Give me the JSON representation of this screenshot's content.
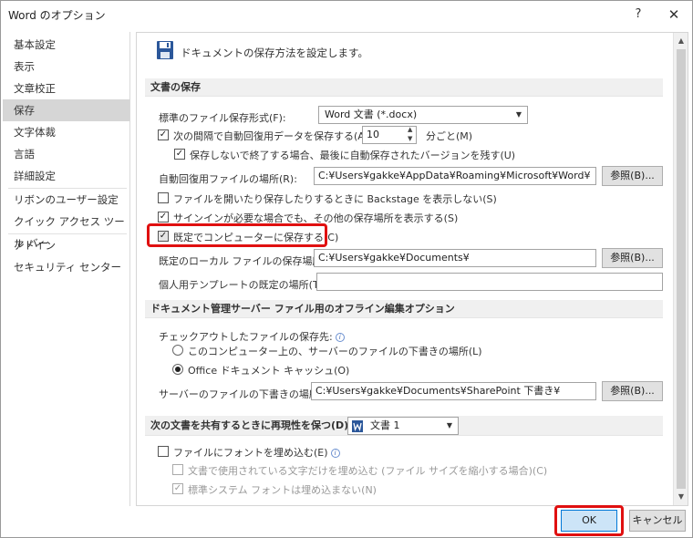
{
  "window": {
    "title": "Word のオプション",
    "help": "?",
    "close": "✕"
  },
  "sidebar": {
    "items": [
      "基本設定",
      "表示",
      "文章校正",
      "保存",
      "文字体裁",
      "言語",
      "詳細設定",
      "リボンのユーザー設定",
      "クイック アクセス ツール バー",
      "アドイン",
      "セキュリティ センター"
    ],
    "selected": "保存"
  },
  "header": {
    "text": "ドキュメントの保存方法を設定します。"
  },
  "sections": {
    "save": "文書の保存",
    "offline": "ドキュメント管理サーバー ファイル用のオフライン編集オプション",
    "share": "次の文書を共有するときに再現性を保つ(D):"
  },
  "save": {
    "format_label": "標準のファイル保存形式(F):",
    "format_value": "Word 文書 (*.docx)",
    "autorecover_label": "次の間隔で自動回復用データを保存する(A):",
    "autorecover_checked": true,
    "interval_value": "10",
    "interval_unit": "分ごと(M)",
    "keep_last_label": "保存しないで終了する場合、最後に自動保存されたバージョンを残す(U)",
    "keep_last_checked": true,
    "autorecover_loc_label": "自動回復用ファイルの場所(R):",
    "autorecover_loc_value": "C:¥Users¥gakke¥AppData¥Roaming¥Microsoft¥Word¥",
    "browse_label": "参照(B)...",
    "backstage_label": "ファイルを開いたり保存したりするときに Backstage を表示しない(S)",
    "backstage_checked": false,
    "signin_label": "サインインが必要な場合でも、その他の保存場所を表示する(S)",
    "signin_checked": true,
    "default_computer_label": "既定でコンピューターに保存する(C)",
    "default_computer_checked": true,
    "local_loc_label": "既定のローカル ファイルの保存場所(I):",
    "local_loc_value": "C:¥Users¥gakke¥Documents¥",
    "template_label": "個人用テンプレートの既定の場所(T):",
    "template_value": ""
  },
  "offline": {
    "checkout_label": "チェックアウトしたファイルの保存先:",
    "radio1_label": "このコンピューター上の、サーバーのファイルの下書きの場所(L)",
    "radio2_label": "Office ドキュメント キャッシュ(O)",
    "selected": "Office ドキュメント キャッシュ(O)",
    "drafts_label": "サーバーのファイルの下書きの場所(V):",
    "drafts_value": "C:¥Users¥gakke¥Documents¥SharePoint 下書き¥"
  },
  "share": {
    "doc_value": "文書 1",
    "embed_fonts_label": "ファイルにフォントを埋め込む(E)",
    "embed_fonts_checked": false,
    "embed_used_label": "文書で使用されている文字だけを埋め込む (ファイル サイズを縮小する場合)(C)",
    "no_system_label": "標準システム フォントは埋め込まない(N)"
  },
  "footer": {
    "ok": "OK",
    "cancel": "キャンセル"
  },
  "colors": {
    "highlight": "#e01010",
    "selected_nav": "#d6d6d6",
    "accent": "#2b579a"
  }
}
